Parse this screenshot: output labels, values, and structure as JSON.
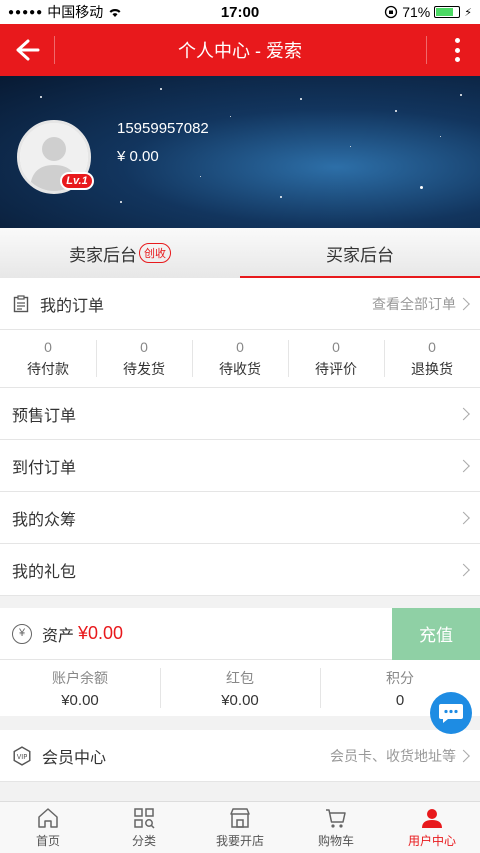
{
  "status_bar": {
    "carrier": "中国移动",
    "time": "17:00",
    "battery": "71%"
  },
  "header": {
    "title": "个人中心 - 爱索"
  },
  "profile": {
    "phone": "15959957082",
    "balance": "¥ 0.00",
    "level": "Lv.1"
  },
  "tabs": [
    {
      "label": "卖家后台",
      "badge": "创收"
    },
    {
      "label": "买家后台"
    }
  ],
  "orders": {
    "title": "我的订单",
    "view_all": "查看全部订单",
    "stats": [
      {
        "count": "0",
        "label": "待付款"
      },
      {
        "count": "0",
        "label": "待发货"
      },
      {
        "count": "0",
        "label": "待收货"
      },
      {
        "count": "0",
        "label": "待评价"
      },
      {
        "count": "0",
        "label": "退换货"
      }
    ]
  },
  "menu": [
    "预售订单",
    "到付订单",
    "我的众筹",
    "我的礼包"
  ],
  "assets": {
    "label": "资产",
    "amount": "¥0.00",
    "recharge": "充值",
    "items": [
      {
        "label": "账户余额",
        "value": "¥0.00"
      },
      {
        "label": "红包",
        "value": "¥0.00"
      },
      {
        "label": "积分",
        "value": "0"
      }
    ]
  },
  "member": {
    "title": "会员中心",
    "hint": "会员卡、收货地址等"
  },
  "tabbar": [
    {
      "label": "首页",
      "icon": "home-icon"
    },
    {
      "label": "分类",
      "icon": "category-icon"
    },
    {
      "label": "我要开店",
      "icon": "store-icon"
    },
    {
      "label": "购物车",
      "icon": "cart-icon"
    },
    {
      "label": "用户中心",
      "icon": "user-icon",
      "active": true
    }
  ],
  "colors": {
    "brand": "#e8191c",
    "recharge": "#8fd0a5",
    "chat": "#1e8ce3"
  }
}
